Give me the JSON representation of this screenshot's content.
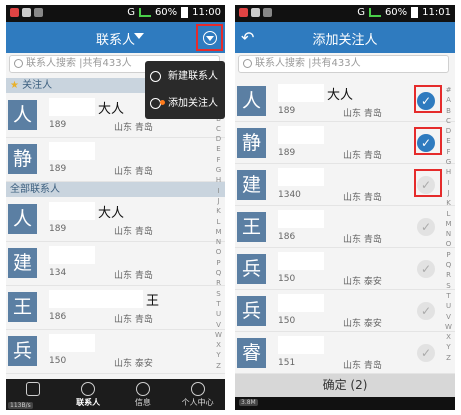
{
  "status": {
    "battery": "60%",
    "left_time": "11:00",
    "right_time": "11:01",
    "network": "G"
  },
  "left": {
    "title": "联系人",
    "search_placeholder": "联系人搜索 |共有433人",
    "section_favorites": "关注人",
    "section_all": "全部联系人",
    "menu": {
      "new_contact": "新建联系人",
      "add_favorite": "添加关注人"
    },
    "rows": [
      {
        "avatar": "人",
        "suffix": "大人",
        "phone": "189",
        "location": "山东 青岛"
      },
      {
        "avatar": "静",
        "suffix": "",
        "phone": "189",
        "location": "山东 青岛"
      },
      {
        "avatar": "人",
        "suffix": "大人",
        "phone": "189",
        "location": "山东 青岛"
      },
      {
        "avatar": "建",
        "suffix": "",
        "phone": "134",
        "location": "山东 青岛"
      },
      {
        "avatar": "王",
        "suffix": "王",
        "phone": "186",
        "location": "山东 青岛"
      },
      {
        "avatar": "兵",
        "suffix": "",
        "phone": "150",
        "location": "山东 泰安"
      }
    ],
    "index_letters": [
      "#",
      "A",
      "B",
      "C",
      "D",
      "E",
      "F",
      "G",
      "H",
      "I",
      "J",
      "K",
      "L",
      "M",
      "N",
      "O",
      "P",
      "Q",
      "R",
      "S",
      "T",
      "U",
      "V",
      "W",
      "X",
      "Y",
      "Z"
    ],
    "nav": [
      {
        "label": ""
      },
      {
        "label": "联系人"
      },
      {
        "label": "信息"
      },
      {
        "label": "个人中心"
      }
    ],
    "net_speed": "113B/s"
  },
  "right": {
    "title": "添加关注人",
    "back_icon": "↶",
    "search_placeholder": "联系人搜索 |共有433人",
    "rows": [
      {
        "avatar": "人",
        "suffix": "大人",
        "phone": "189",
        "location": "山东 青岛",
        "checked": true,
        "highlight": true
      },
      {
        "avatar": "静",
        "suffix": "",
        "phone": "189",
        "location": "山东 青岛",
        "checked": true,
        "highlight": true
      },
      {
        "avatar": "建",
        "suffix": "",
        "phone": "1340",
        "location": "山东 青岛",
        "checked": false,
        "highlight": true
      },
      {
        "avatar": "王",
        "suffix": "",
        "phone": "186",
        "location": "山东 青岛",
        "checked": false,
        "highlight": false
      },
      {
        "avatar": "兵",
        "suffix": "",
        "phone": "150",
        "location": "山东 泰安",
        "checked": false,
        "highlight": false
      },
      {
        "avatar": "兵",
        "suffix": "",
        "phone": "150",
        "location": "山东 泰安",
        "checked": false,
        "highlight": false
      },
      {
        "avatar": "睿",
        "suffix": "",
        "phone": "151",
        "location": "山东 青岛",
        "checked": false,
        "highlight": false
      }
    ],
    "index_letters": [
      "#",
      "A",
      "B",
      "C",
      "D",
      "E",
      "F",
      "G",
      "H",
      "I",
      "J",
      "K",
      "L",
      "M",
      "N",
      "O",
      "P",
      "Q",
      "R",
      "S",
      "T",
      "U",
      "V",
      "W",
      "X",
      "Y",
      "Z"
    ],
    "confirm": "确定 (2)",
    "net_speed": "3.8M"
  }
}
